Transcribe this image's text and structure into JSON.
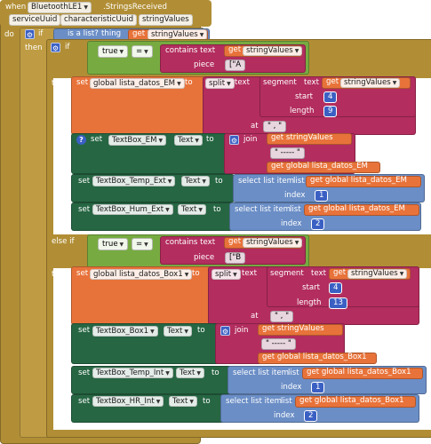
{
  "event": {
    "when": "when",
    "component": "BluetoothLE1",
    "event_name": ".StringsReceived",
    "params": [
      "serviceUuid",
      "characteristicUuid",
      "stringValues"
    ],
    "do": "do"
  },
  "if1": {
    "if_label": "if",
    "is_list": "is a list?",
    "thing": "thing",
    "get": "get",
    "var": "stringValues",
    "then": "then"
  },
  "inner_if": {
    "if_label": "if",
    "bool": "true",
    "op": "=",
    "contains_text": "contains text",
    "piece": "piece",
    "get": "get",
    "var": "stringValues",
    "piece_value": "[\"A"
  },
  "branch_em": {
    "then": "then",
    "set": "set",
    "global_var": "global lista_datos_EM",
    "to": "to",
    "split": "split",
    "text": "text",
    "segment": "segment",
    "text2": "text",
    "start": "start",
    "start_val": "4",
    "length": "length",
    "length_val": "9",
    "at": "at",
    "at_val": "\" , \"",
    "get": "get",
    "var": "stringValues",
    "setters": [
      {
        "set": "set",
        "component": "TextBox_EM",
        "prop": "Text",
        "to": "to",
        "kind": "join",
        "join": "join",
        "items": [
          "get stringValues",
          "\" ----- \"",
          "get global lista_datos_EM"
        ]
      },
      {
        "set": "set",
        "component": "TextBox_Temp_Ext",
        "prop": "Text",
        "to": "to",
        "select": "select list item",
        "list": "list",
        "list_val": "get global lista_datos_EM",
        "index": "index",
        "index_val": "1"
      },
      {
        "set": "set",
        "component": "TextBox_Hum_Ext",
        "prop": "Text",
        "to": "to",
        "select": "select list item",
        "list": "list",
        "list_val": "get global lista_datos_EM",
        "index": "index",
        "index_val": "2"
      }
    ]
  },
  "else_if": {
    "label": "else if",
    "bool": "true",
    "op": "=",
    "contains_text": "contains text",
    "piece": "piece",
    "get": "get",
    "var": "stringValues",
    "piece_value": "[\"B"
  },
  "branch_box": {
    "then": "then",
    "set": "set",
    "global_var": "global lista_datos_Box1",
    "to": "to",
    "split": "split",
    "text": "text",
    "segment": "segment",
    "text2": "text",
    "start": "start",
    "start_val": "4",
    "length": "length",
    "length_val": "13",
    "at": "at",
    "at_val": "\" , \"",
    "get": "get",
    "var": "stringValues",
    "setters": [
      {
        "set": "set",
        "component": "TextBox_Box1",
        "prop": "Text",
        "to": "to",
        "join": "join",
        "items": [
          "get stringValues",
          "\" ----- \"",
          "get global lista_datos_Box1"
        ]
      },
      {
        "set": "set",
        "component": "TextBox_Temp_Int",
        "prop": "Text",
        "to": "to",
        "select": "select list item",
        "list": "list",
        "list_val": "get global lista_datos_Box1",
        "index": "index",
        "index_val": "1"
      },
      {
        "set": "set",
        "component": "TextBox_HR_Int",
        "prop": "Text",
        "to": "to",
        "select": "select list item",
        "list": "list",
        "list_val": "get global lista_datos_Box1",
        "index": "index",
        "index_val": "2"
      }
    ]
  },
  "colors": {
    "event": "#b18e35",
    "get": "#e8733a",
    "text": "#b32d5e",
    "list": "#6b8ec6",
    "setter": "#266643",
    "math": "#3b60c4",
    "logic": "#77ab41"
  }
}
